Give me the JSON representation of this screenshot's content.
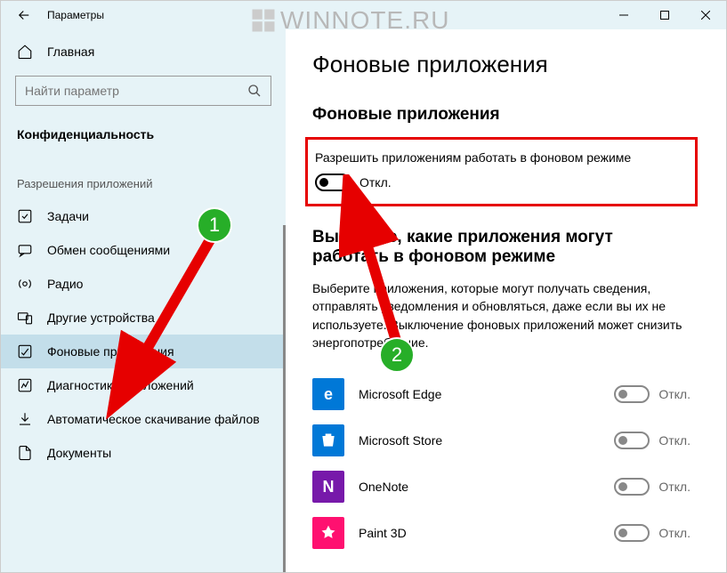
{
  "titlebar": {
    "title": "Параметры"
  },
  "watermark": {
    "text": "WINNOTE",
    "suffix": "RU"
  },
  "sidebar": {
    "home": "Главная",
    "search_placeholder": "Найти параметр",
    "category": "Конфиденциальность",
    "subheading": "Разрешения приложений",
    "items": [
      {
        "label": "Задачи"
      },
      {
        "label": "Обмен сообщениями"
      },
      {
        "label": "Радио"
      },
      {
        "label": "Другие устройства"
      },
      {
        "label": "Фоновые приложения"
      },
      {
        "label": "Диагностика приложений"
      },
      {
        "label": "Автоматическое скачивание файлов"
      },
      {
        "label": "Документы"
      }
    ]
  },
  "main": {
    "title": "Фоновые приложения",
    "section1_heading": "Фоновые приложения",
    "master_label": "Разрешить приложениям работать в фоновом режиме",
    "master_state": "Откл.",
    "section2_heading": "Выберите, какие приложения могут работать в фоновом режиме",
    "desc": "Выберите приложения, которые могут получать сведения, отправлять уведомления и обновляться, даже если вы их не используете. Выключение фоновых приложений может снизить энергопотребление.",
    "apps": [
      {
        "name": "Microsoft Edge",
        "state": "Откл.",
        "bg": "#0078d7",
        "char": "e"
      },
      {
        "name": "Microsoft Store",
        "state": "Откл.",
        "bg": "#0078d7",
        "char": ""
      },
      {
        "name": "OneNote",
        "state": "Откл.",
        "bg": "#7719aa",
        "char": "N"
      },
      {
        "name": "Paint 3D",
        "state": "Откл.",
        "bg": "#ff1070",
        "char": ""
      }
    ]
  },
  "annotations": {
    "b1": "1",
    "b2": "2"
  }
}
